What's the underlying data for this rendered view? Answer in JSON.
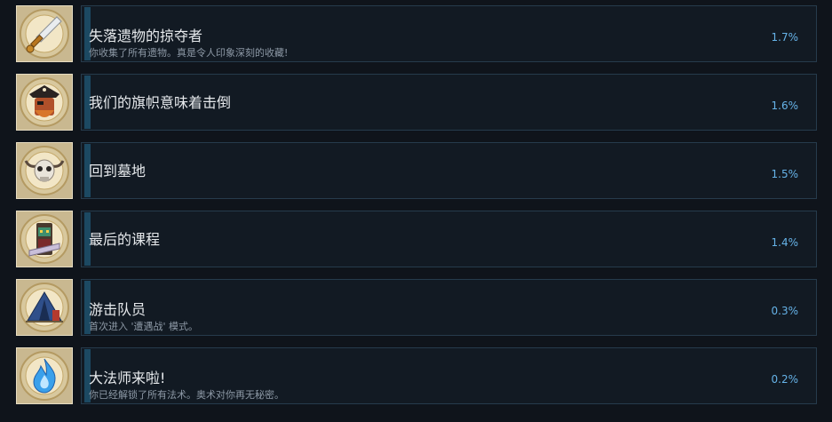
{
  "achievements": [
    {
      "title": "失落遗物的掠夺者",
      "desc": "你收集了所有遗物。真是令人印象深刻的收藏!",
      "percent": "1.7%",
      "icon": "dagger-icon",
      "progress": 0.2
    },
    {
      "title": "我们的旗帜意味着击倒",
      "desc": "",
      "percent": "1.6%",
      "icon": "pirate-captain-icon",
      "progress": 0.0
    },
    {
      "title": "回到墓地",
      "desc": "",
      "percent": "1.5%",
      "icon": "horned-skull-icon",
      "progress": 0.0
    },
    {
      "title": "最后的课程",
      "desc": "",
      "percent": "1.4%",
      "icon": "totem-mask-icon",
      "progress": 0.0
    },
    {
      "title": "游击队员",
      "desc": "首次进入 '遭遇战' 模式。",
      "percent": "0.3%",
      "icon": "tent-icon",
      "progress": 0.0
    },
    {
      "title": "大法师来啦!",
      "desc": "你已经解锁了所有法术。奥术对你再无秘密。",
      "percent": "0.2%",
      "icon": "blue-flame-icon",
      "progress": 0.0
    }
  ],
  "colors": {
    "background": "#0f141b",
    "panel": "#121a23",
    "panel_border": "#263b4c",
    "progress_bar": "#1c4962",
    "percent_text": "#66b3e8",
    "icon_frame": "#c9b890"
  }
}
